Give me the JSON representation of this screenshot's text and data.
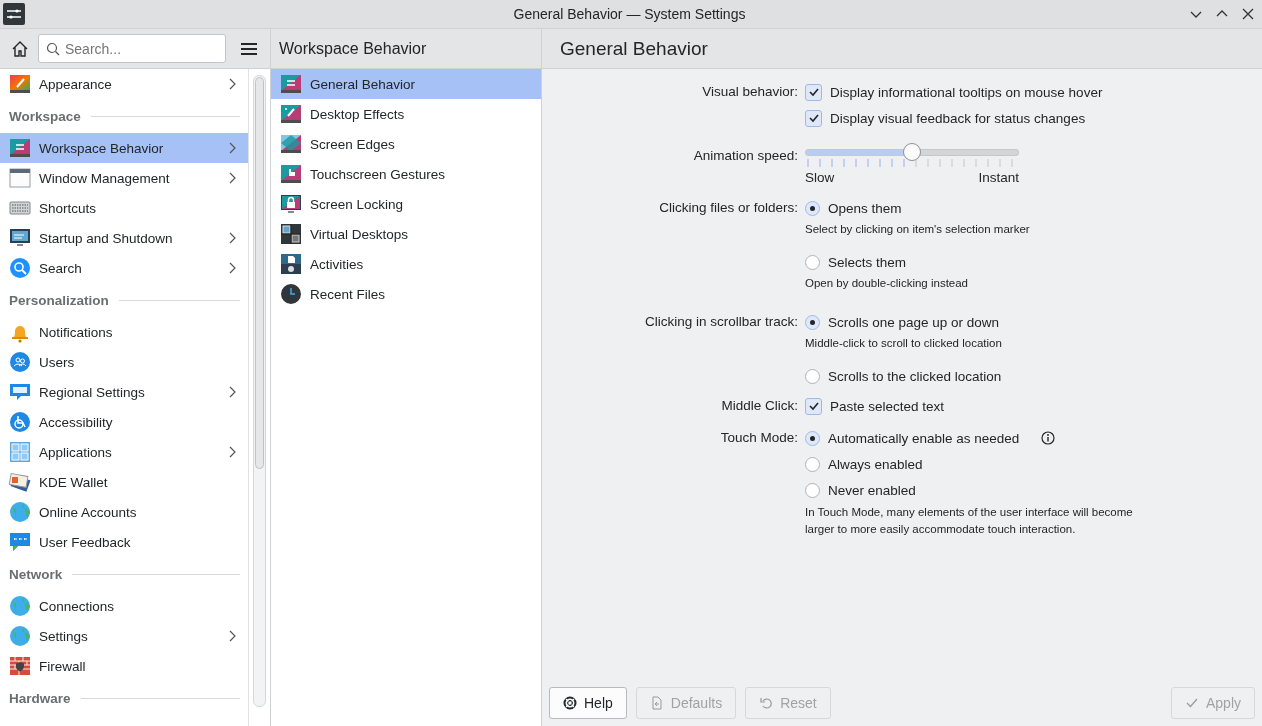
{
  "window": {
    "title": "General Behavior — System Settings"
  },
  "sidebar": {
    "search": {
      "placeholder": "Search..."
    },
    "groups": [
      {
        "items": [
          {
            "label": "Appearance",
            "selected": false,
            "expandable": true
          }
        ]
      },
      {
        "title": "Workspace",
        "items": [
          {
            "label": "Workspace Behavior",
            "selected": true,
            "expandable": true
          },
          {
            "label": "Window Management",
            "selected": false,
            "expandable": true
          },
          {
            "label": "Shortcuts",
            "selected": false,
            "expandable": false
          },
          {
            "label": "Startup and Shutdown",
            "selected": false,
            "expandable": true
          },
          {
            "label": "Search",
            "selected": false,
            "expandable": true
          }
        ]
      },
      {
        "title": "Personalization",
        "items": [
          {
            "label": "Notifications",
            "selected": false,
            "expandable": false
          },
          {
            "label": "Users",
            "selected": false,
            "expandable": false
          },
          {
            "label": "Regional Settings",
            "selected": false,
            "expandable": true
          },
          {
            "label": "Accessibility",
            "selected": false,
            "expandable": false
          },
          {
            "label": "Applications",
            "selected": false,
            "expandable": true
          },
          {
            "label": "KDE Wallet",
            "selected": false,
            "expandable": false
          },
          {
            "label": "Online Accounts",
            "selected": false,
            "expandable": false
          },
          {
            "label": "User Feedback",
            "selected": false,
            "expandable": false
          }
        ]
      },
      {
        "title": "Network",
        "items": [
          {
            "label": "Connections",
            "selected": false,
            "expandable": false
          },
          {
            "label": "Settings",
            "selected": false,
            "expandable": true
          },
          {
            "label": "Firewall",
            "selected": false,
            "expandable": false
          }
        ]
      },
      {
        "title": "Hardware"
      }
    ]
  },
  "subpage_list": {
    "title": "Workspace Behavior",
    "items": [
      {
        "label": "General Behavior",
        "selected": true
      },
      {
        "label": "Desktop Effects",
        "selected": false
      },
      {
        "label": "Screen Edges",
        "selected": false
      },
      {
        "label": "Touchscreen Gestures",
        "selected": false
      },
      {
        "label": "Screen Locking",
        "selected": false
      },
      {
        "label": "Virtual Desktops",
        "selected": false
      },
      {
        "label": "Activities",
        "selected": false
      },
      {
        "label": "Recent Files",
        "selected": false
      }
    ]
  },
  "content": {
    "title": "General Behavior",
    "rows": [
      {
        "kind": "checks",
        "label": "Visual behavior:",
        "options": [
          {
            "text": "Display informational tooltips on mouse hover",
            "checked": true
          },
          {
            "text": "Display visual feedback for status changes",
            "checked": true
          }
        ]
      },
      {
        "kind": "slider",
        "label": "Animation speed:",
        "level": 0.5,
        "min_label": "Slow",
        "max_label": "Instant"
      },
      {
        "kind": "radios",
        "label": "Clicking files or folders:",
        "options": [
          {
            "text": "Opens them",
            "selected": true,
            "note": "Select by clicking on item's selection marker"
          },
          {
            "text": "Selects them",
            "selected": false,
            "note": "Open by double-clicking instead"
          }
        ]
      },
      {
        "kind": "radios",
        "label": "Clicking in scrollbar track:",
        "options": [
          {
            "text": "Scrolls one page up or down",
            "selected": true,
            "note": "Middle-click to scroll to clicked location"
          },
          {
            "text": "Scrolls to the clicked location",
            "selected": false
          }
        ]
      },
      {
        "kind": "checks",
        "label": "Middle Click:",
        "options": [
          {
            "text": "Paste selected text",
            "checked": true
          }
        ]
      },
      {
        "kind": "radios",
        "label": "Touch Mode:",
        "options": [
          {
            "text": "Automatically enable as needed",
            "selected": true,
            "info": true
          },
          {
            "text": "Always enabled",
            "selected": false
          },
          {
            "text": "Never enabled",
            "selected": false
          }
        ],
        "note": "In Touch Mode, many elements of the user interface will become larger to more easily accommodate touch interaction."
      }
    ]
  },
  "footer": {
    "buttons": [
      {
        "label": "Help",
        "kind": "help",
        "disabled": false
      },
      {
        "label": "Defaults",
        "kind": "defaults",
        "disabled": true
      },
      {
        "label": "Reset",
        "kind": "reset",
        "disabled": true
      },
      {
        "label": "Apply",
        "kind": "apply",
        "disabled": true
      }
    ]
  }
}
